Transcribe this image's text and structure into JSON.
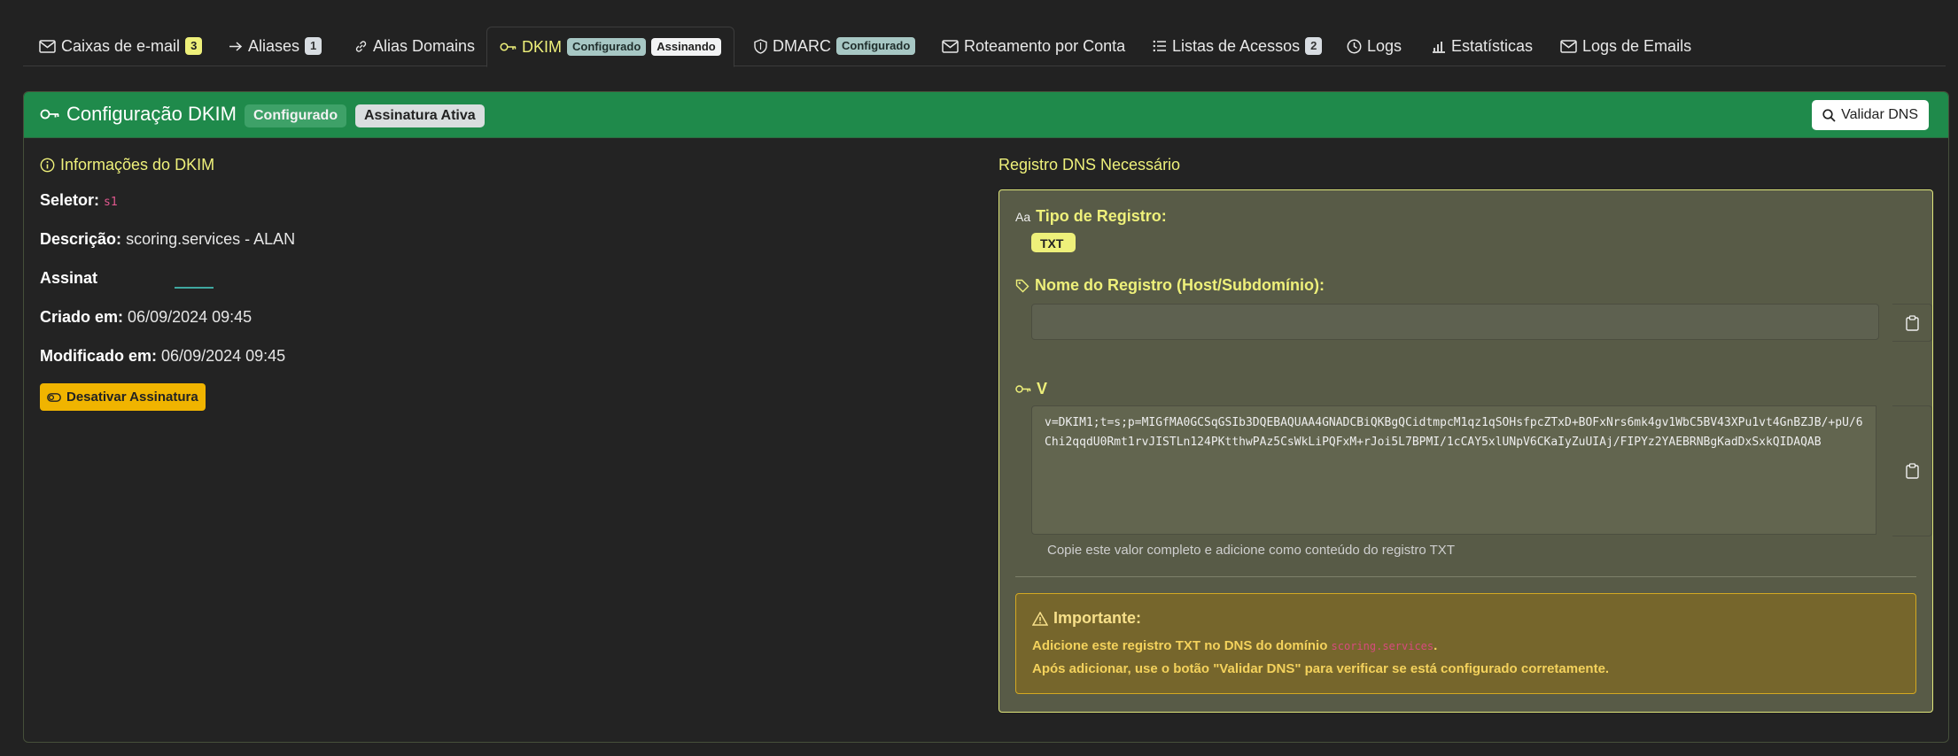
{
  "tabs": [
    {
      "label": "Caixas de e-mail",
      "badge": "3",
      "icon": "envelope-icon"
    },
    {
      "label": "Aliases",
      "badge": "1",
      "icon": "forward-arrow-icon"
    },
    {
      "label": "Alias Domains",
      "icon": "link-icon"
    },
    {
      "label": "DKIM",
      "badges": [
        "Configurado",
        "Assinando"
      ],
      "icon": "key-icon",
      "active": true
    },
    {
      "label": "DMARC",
      "badge": "Configurado",
      "icon": "shield-icon"
    },
    {
      "label": "Roteamento por Conta",
      "icon": "envelope-route-icon"
    },
    {
      "label": "Listas de Acessos",
      "badge": "2",
      "icon": "list-icon"
    },
    {
      "label": "Logs",
      "icon": "clock-icon"
    },
    {
      "label": "Estatísticas",
      "icon": "bar-chart-icon"
    },
    {
      "label": "Logs de Emails",
      "icon": "envelope-check-icon"
    }
  ],
  "header": {
    "title": "Configuração DKIM",
    "badge_configured": "Configurado",
    "badge_signing": "Assinatura Ativa",
    "validate_button": "Validar DNS"
  },
  "info": {
    "heading": "Informações do DKIM",
    "selector_label": "Seletor:",
    "selector_value": "s1",
    "description_label": "Descrição:",
    "description_value": "scoring.services - ALAN",
    "signature_label": "Assinat",
    "created_label": "Criado em:",
    "created_value": "06/09/2024 09:45",
    "modified_label": "Modificado em:",
    "modified_value": "06/09/2024 09:45",
    "deactivate_button": "Desativar Assinatura"
  },
  "dns": {
    "heading": "Registro DNS Necessário",
    "type_label": "Tipo de Registro:",
    "type_value": "TXT",
    "name_label": "Nome do Registro (Host/Subdomínio):",
    "name_value": "",
    "value_label": "V",
    "record_value": "v=DKIM1;t=s;p=MIGfMA0GCSqGSIb3DQEBAQUAA4GNADCBiQKBgQCidtmpcM1qz1qSOHsfpcZTxD+BOFxNrs6mk4gv1WbC5BV43XPu1vt4GnBZJB/+pU/6Chi2qqdU0Rmt1rvJISTLn124PKtthwPAz5CsWkLiPQFxM+rJoi5L7BPMI/1cCAY5xlUNpV6CKaIyZuUIAj/FIPYz2YAEBRNBgKadDxSxkQIDAQAB",
    "help_text": "Copie este valor completo e adicione como conteúdo do registro TXT",
    "alert_title": "Importante:",
    "alert_line1_prefix": "Adicione este registro TXT no DNS do domínio",
    "alert_domain": "scoring.services",
    "alert_line1_suffix": ".",
    "alert_line2": "Após adicionar, use o botão \"Validar DNS\" para verificar se está configurado corretamente."
  },
  "colors": {
    "accent": "#eef07a",
    "header_green": "#1f8a4b",
    "warning": "#f0b400"
  }
}
